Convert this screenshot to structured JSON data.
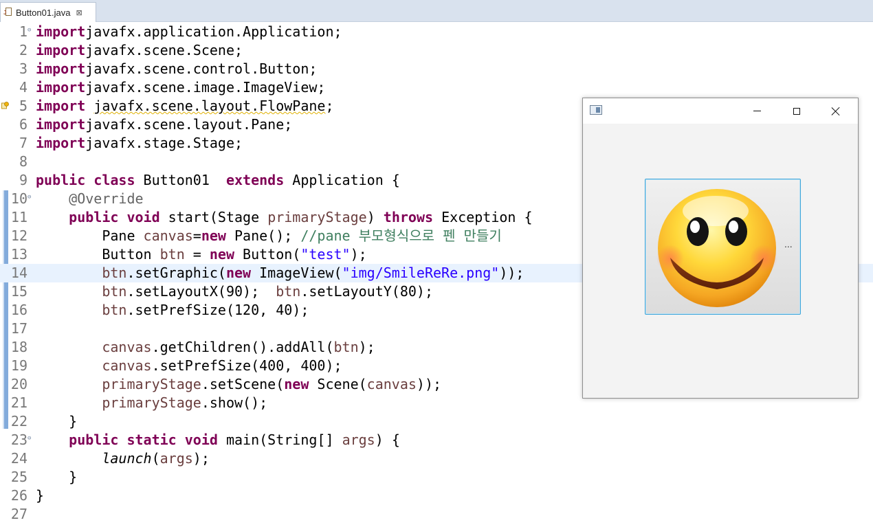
{
  "tab": {
    "title": "Button01.java",
    "close": "⊠"
  },
  "editor": {
    "current_line": 14,
    "fold_lines": [
      1,
      10,
      23
    ],
    "warning_line": 5,
    "lines": [
      {
        "n": "1",
        "t": [
          [
            "kw",
            "import"
          ],
          [
            "",
            "javafx.application.Application;"
          ]
        ]
      },
      {
        "n": "2",
        "t": [
          [
            "kw",
            "import"
          ],
          [
            "",
            "javafx.scene.Scene;"
          ]
        ]
      },
      {
        "n": "3",
        "t": [
          [
            "kw",
            "import"
          ],
          [
            "",
            "javafx.scene.control.Button;"
          ]
        ]
      },
      {
        "n": "4",
        "t": [
          [
            "kw",
            "import"
          ],
          [
            "",
            "javafx.scene.image.ImageView;"
          ]
        ]
      },
      {
        "n": "5",
        "t": [
          [
            "kw",
            "import"
          ],
          [
            "",
            " "
          ],
          [
            "squig",
            "javafx.scene.layout.FlowPane"
          ],
          [
            "",
            ";"
          ]
        ]
      },
      {
        "n": "6",
        "t": [
          [
            "kw",
            "import"
          ],
          [
            "",
            "javafx.scene.layout.Pane;"
          ]
        ]
      },
      {
        "n": "7",
        "t": [
          [
            "kw",
            "import"
          ],
          [
            "",
            "javafx.stage.Stage;"
          ]
        ]
      },
      {
        "n": "8",
        "t": []
      },
      {
        "n": "9",
        "t": [
          [
            "kw",
            "public"
          ],
          [
            "",
            " "
          ],
          [
            "kw",
            "class"
          ],
          [
            "",
            " Button01  "
          ],
          [
            "kw",
            "extends"
          ],
          [
            "",
            " Application {"
          ]
        ]
      },
      {
        "n": "10",
        "t": [
          [
            "",
            "    "
          ],
          [
            "ann",
            "@Override"
          ]
        ]
      },
      {
        "n": "11",
        "t": [
          [
            "",
            "    "
          ],
          [
            "kw",
            "public"
          ],
          [
            "",
            " "
          ],
          [
            "kw",
            "void"
          ],
          [
            "",
            " start(Stage "
          ],
          [
            "lv",
            "primaryStage"
          ],
          [
            "",
            ") "
          ],
          [
            "kw",
            "throws"
          ],
          [
            "",
            " Exception {"
          ]
        ]
      },
      {
        "n": "12",
        "t": [
          [
            "",
            "        Pane "
          ],
          [
            "lv",
            "canvas"
          ],
          [
            "",
            "="
          ],
          [
            "kw",
            "new"
          ],
          [
            "",
            " Pane(); "
          ],
          [
            "cmt",
            "//pane 부모형식으로 펜 만들기"
          ]
        ]
      },
      {
        "n": "13",
        "t": [
          [
            "",
            "        Button "
          ],
          [
            "lv",
            "btn"
          ],
          [
            "",
            " = "
          ],
          [
            "kw",
            "new"
          ],
          [
            "",
            " Button("
          ],
          [
            "str",
            "\"test\""
          ],
          [
            "",
            ");"
          ]
        ]
      },
      {
        "n": "14",
        "t": [
          [
            "",
            "        "
          ],
          [
            "lv",
            "btn"
          ],
          [
            "",
            ".setGraphic("
          ],
          [
            "kw",
            "new"
          ],
          [
            "",
            " ImageView("
          ],
          [
            "str",
            "\"img/SmileReRe.png\""
          ],
          [
            "",
            "));"
          ]
        ]
      },
      {
        "n": "15",
        "t": [
          [
            "",
            "        "
          ],
          [
            "lv",
            "btn"
          ],
          [
            "",
            ".setLayoutX(90);  "
          ],
          [
            "lv",
            "btn"
          ],
          [
            "",
            ".setLayoutY(80);"
          ]
        ]
      },
      {
        "n": "16",
        "t": [
          [
            "",
            "        "
          ],
          [
            "lv",
            "btn"
          ],
          [
            "",
            ".setPrefSize(120, 40);"
          ]
        ]
      },
      {
        "n": "17",
        "t": []
      },
      {
        "n": "18",
        "t": [
          [
            "",
            "        "
          ],
          [
            "lv",
            "canvas"
          ],
          [
            "",
            ".getChildren().addAll("
          ],
          [
            "lv",
            "btn"
          ],
          [
            "",
            ");"
          ]
        ]
      },
      {
        "n": "19",
        "t": [
          [
            "",
            "        "
          ],
          [
            "lv",
            "canvas"
          ],
          [
            "",
            ".setPrefSize(400, 400);"
          ]
        ]
      },
      {
        "n": "20",
        "t": [
          [
            "",
            "        "
          ],
          [
            "lv",
            "primaryStage"
          ],
          [
            "",
            ".setScene("
          ],
          [
            "kw",
            "new"
          ],
          [
            "",
            " Scene("
          ],
          [
            "lv",
            "canvas"
          ],
          [
            "",
            "));"
          ]
        ]
      },
      {
        "n": "21",
        "t": [
          [
            "",
            "        "
          ],
          [
            "lv",
            "primaryStage"
          ],
          [
            "",
            ".show();"
          ]
        ]
      },
      {
        "n": "22",
        "t": [
          [
            "",
            "    }"
          ]
        ]
      },
      {
        "n": "23",
        "t": [
          [
            "",
            "    "
          ],
          [
            "kw",
            "public"
          ],
          [
            "",
            " "
          ],
          [
            "kw",
            "static"
          ],
          [
            "",
            " "
          ],
          [
            "kw",
            "void"
          ],
          [
            "",
            " main(String[] "
          ],
          [
            "lv",
            "args"
          ],
          [
            "",
            ") {"
          ]
        ]
      },
      {
        "n": "24",
        "t": [
          [
            "",
            "        "
          ],
          [
            "ital",
            "launch"
          ],
          [
            "",
            "("
          ],
          [
            "lv",
            "args"
          ],
          [
            "",
            ");"
          ]
        ]
      },
      {
        "n": "25",
        "t": [
          [
            "",
            "    }"
          ]
        ]
      },
      {
        "n": "26",
        "t": [
          [
            "",
            "}"
          ]
        ]
      },
      {
        "n": "27",
        "t": []
      }
    ]
  },
  "fx_window": {
    "button_text": "...",
    "icons": {
      "app": "window-app-icon",
      "minimize": "minimize-icon",
      "maximize": "maximize-icon",
      "close": "close-icon",
      "graphic": "smiley-face-icon"
    }
  },
  "colors": {
    "keyword": "#7f0055",
    "string": "#2a00ff",
    "comment": "#3f7f5f",
    "annotation": "#646464",
    "local_var": "#6a3e3e",
    "button_focus": "#3fa6da"
  }
}
